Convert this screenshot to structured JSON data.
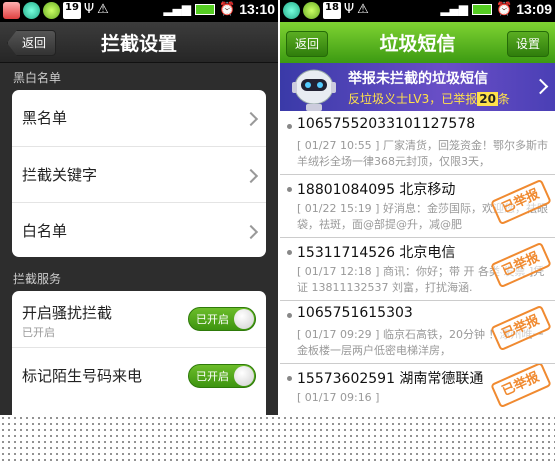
{
  "left": {
    "status_time": "13:10",
    "status_badge": "19",
    "back_label": "返回",
    "title": "拦截设置",
    "section1": "黑白名单",
    "list_items": [
      {
        "label": "黑名单"
      },
      {
        "label": "拦截关键字"
      },
      {
        "label": "白名单"
      }
    ],
    "section2": "拦截服务",
    "services": [
      {
        "label": "开启骚扰拦截",
        "sub": "已开启",
        "toggle": "已开启",
        "enabled": true
      },
      {
        "label": "标记陌生号码来电",
        "sub": "",
        "toggle": "已开启",
        "enabled": true
      }
    ]
  },
  "right": {
    "status_time": "13:09",
    "status_badge": "18",
    "back_label": "返回",
    "title": "垃圾短信",
    "settings_label": "设置",
    "banner_line1": "举报未拦截的垃圾短信",
    "banner_line2_pre": "反垃圾义士LV3，已举报",
    "banner_count": "20",
    "banner_line2_post": "条",
    "stamp_text": "已举报",
    "messages": [
      {
        "sender": "10657552033101127578",
        "preview": "[ 01/27 10:55 ] 厂家清货，回笼资金！鄂尔多斯市羊绒衫全场一律368元封顶，仅限3天，",
        "reported": false
      },
      {
        "sender": "18801084095 北京移动",
        "preview": "[ 01/22 15:19 ] 好消息：金莎国际，欢迎您，祛眼袋，祛斑，面@部提@升，减@肥",
        "reported": true
      },
      {
        "sender": "15311714526 北京电信",
        "preview": "[ 01/17 12:18 ] 商讯：你好；带 开 各类 发票 ]凭证 13811132537 刘富，打扰海涵.",
        "reported": true
      },
      {
        "sender": "1065751615303",
        "preview": "[ 01/17 09:29 ] 临京石高铁，20分钟 ！涿州唯一金板楼一层两户低密电梯洋房，",
        "reported": true
      },
      {
        "sender": "15573602591 湖南常德联通",
        "preview": "[ 01/17 09:16 ]",
        "reported": true
      }
    ]
  },
  "colors": {
    "accent_green": "#4caf1c",
    "stamp_orange": "#f08a30",
    "banner_purple": "#5a46c0"
  }
}
